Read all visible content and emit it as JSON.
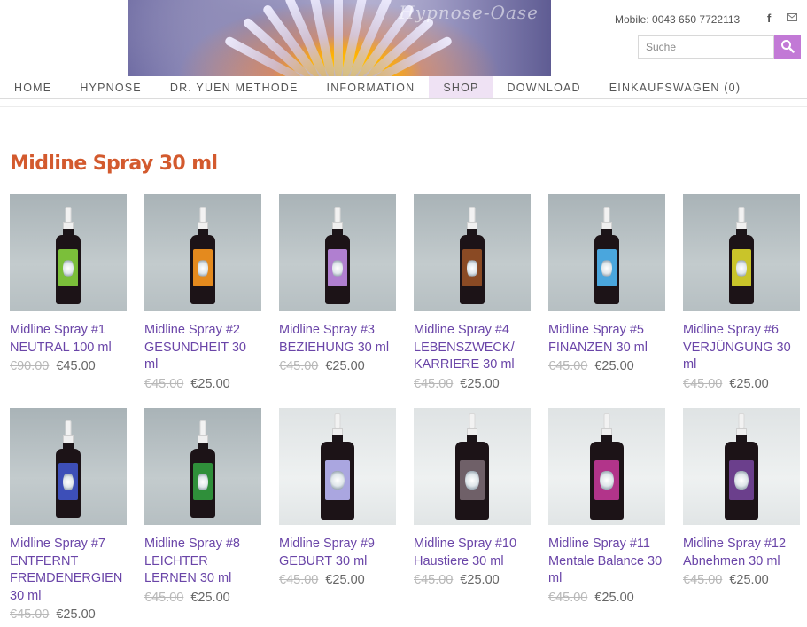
{
  "header": {
    "banner_logo": "Hypnose-Oase",
    "mobile": "Mobile: 0043 650 7722113",
    "facebook_icon": "f",
    "mail_icon": "envelope",
    "search_placeholder": "Suche"
  },
  "nav": {
    "items": [
      {
        "label": "HOME",
        "active": false
      },
      {
        "label": "HYPNOSE",
        "active": false
      },
      {
        "label": "DR. YUEN METHODE",
        "active": false
      },
      {
        "label": "INFORMATION",
        "active": false
      },
      {
        "label": "SHOP",
        "active": true
      },
      {
        "label": "DOWNLOAD",
        "active": false
      },
      {
        "label": "EINKAUFSWAGEN (0)",
        "active": false
      }
    ]
  },
  "page": {
    "title": "Midline Spray 30 ml"
  },
  "colors": {
    "title": "#d35a2e",
    "product_link": "#6a45a8",
    "nav_active_bg": "#efe2f4",
    "search_button": "#c279d6"
  },
  "products": [
    {
      "title": "Midline Spray #1 NEUTRAL 100 ml",
      "old_price": "€90.00",
      "price": "€45.00",
      "label_color": "#7bbf3a"
    },
    {
      "title": "Midline Spray #2 GESUNDHEIT 30 ml",
      "old_price": "€45.00",
      "price": "€25.00",
      "label_color": "#e48a1e"
    },
    {
      "title": "Midline Spray #3 BEZIEHUNG 30 ml",
      "old_price": "€45.00",
      "price": "€25.00",
      "label_color": "#b07fd0"
    },
    {
      "title": "Midline Spray #4 LEBENSZWECK/ KARRIERE 30 ml",
      "old_price": "€45.00",
      "price": "€25.00",
      "label_color": "#8a4a24"
    },
    {
      "title": "Midline Spray #5 FINANZEN 30 ml",
      "old_price": "€45.00",
      "price": "€25.00",
      "label_color": "#4aa6dd"
    },
    {
      "title": "Midline Spray #6 VERJÜNGUNG 30 ml",
      "old_price": "€45.00",
      "price": "€25.00",
      "label_color": "#c9c42a"
    },
    {
      "title": "Midline Spray #7 ENTFERNT FREMDENERGIEN 30 ml",
      "old_price": "€45.00",
      "price": "€25.00",
      "label_color": "#3d4fb8"
    },
    {
      "title": "Midline Spray #8 LEICHTER LERNEN 30 ml",
      "old_price": "€45.00",
      "price": "€25.00",
      "label_color": "#2f8f3a"
    },
    {
      "title": "Midline Spray #9 GEBURT 30 ml",
      "old_price": "€45.00",
      "price": "€25.00",
      "label_color": "#aaa6e0"
    },
    {
      "title": "Midline Spray #10 Haustiere 30 ml",
      "old_price": "€45.00",
      "price": "€25.00",
      "label_color": "#6f6068"
    },
    {
      "title": "Midline Spray #11 Mentale Balance 30 ml",
      "old_price": "€45.00",
      "price": "€25.00",
      "label_color": "#b2348a"
    },
    {
      "title": "Midline Spray #12 Abnehmen 30 ml",
      "old_price": "€45.00",
      "price": "€25.00",
      "label_color": "#6b3f8c"
    }
  ]
}
